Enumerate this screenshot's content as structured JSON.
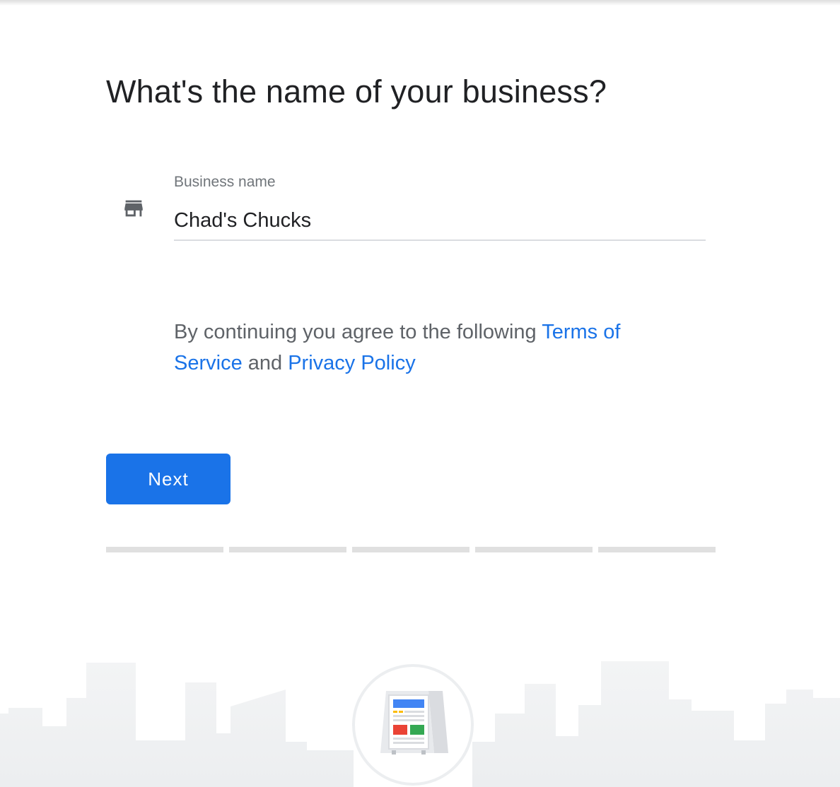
{
  "page": {
    "title": "What's the name of your business?"
  },
  "business_name_field": {
    "label": "Business name",
    "value": "Chad's Chucks",
    "icon": "storefront-icon"
  },
  "terms": {
    "prefix": "By continuing you agree to the following ",
    "terms_link": "Terms of Service",
    "conjunction": " and ",
    "privacy_link": "Privacy Policy"
  },
  "next_button": {
    "label": "Next"
  },
  "progress": {
    "total_steps": 5,
    "completed_steps": 0
  },
  "illustration": {
    "icon": "business-sign-icon",
    "background": "city-skyline"
  },
  "colors": {
    "accent": "#1a73e8",
    "heading": "#202124",
    "muted": "#5f6368",
    "track": "#e0e0e0"
  }
}
